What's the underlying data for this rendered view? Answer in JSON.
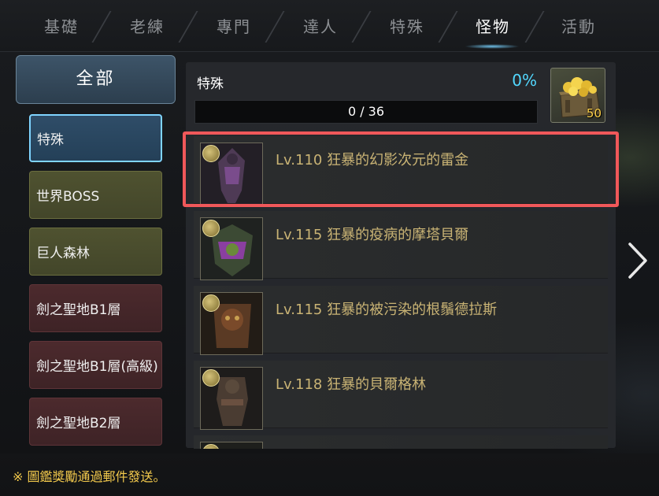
{
  "tabs": [
    {
      "label": "基礎"
    },
    {
      "label": "老練"
    },
    {
      "label": "專門"
    },
    {
      "label": "達人"
    },
    {
      "label": "特殊"
    },
    {
      "label": "怪物"
    },
    {
      "label": "活動"
    }
  ],
  "active_tab": "怪物",
  "sidebar": {
    "all_label": "全部",
    "items": [
      {
        "label": "特殊"
      },
      {
        "label": "世界BOSS"
      },
      {
        "label": "巨人森林"
      },
      {
        "label": "劍之聖地B1層"
      },
      {
        "label": "劍之聖地B1層(高級)"
      },
      {
        "label": "劍之聖地B2層"
      }
    ]
  },
  "panel": {
    "title": "特殊",
    "percent": "0%",
    "progress_text": "0 / 36",
    "progress_fraction": 0,
    "reward_count": "50"
  },
  "list": [
    {
      "label": "Lv.110 狂暴的幻影次元的雷金"
    },
    {
      "label": "Lv.115 狂暴的疫病的摩塔貝爾"
    },
    {
      "label": "Lv.115 狂暴的被污染的根鬚德拉斯"
    },
    {
      "label": "Lv.118 狂暴的貝爾格林"
    }
  ],
  "footer": {
    "note": "※ 圖鑑獎勵通過郵件發送。"
  },
  "colors": {
    "accent_cyan": "#52d8ff",
    "gold_text": "#c9b374",
    "note_yellow": "#f2c94c",
    "highlight_red": "#f0585a"
  }
}
